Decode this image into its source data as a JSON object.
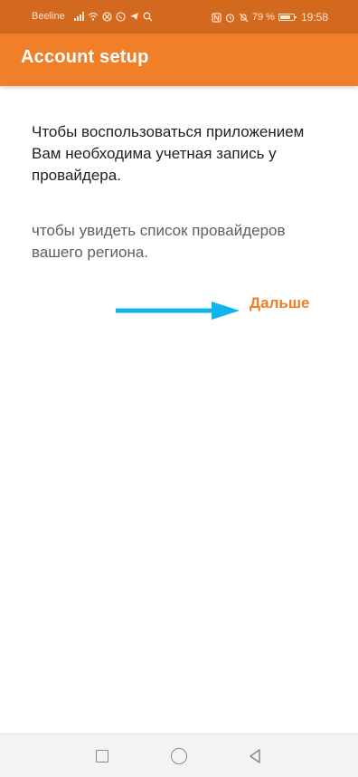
{
  "status_bar": {
    "carrier": "Beeline",
    "battery": "79 %",
    "time": "19:58",
    "icons": [
      "signal-icon",
      "wifi-icon",
      "blocked-icon",
      "whatsapp-icon",
      "telegram-icon",
      "search-icon",
      "nfc-icon",
      "alarm-icon",
      "mute-icon",
      "battery-icon"
    ],
    "battery_level": 0.79
  },
  "app_bar": {
    "title": "Account setup",
    "color": "#f07f2a"
  },
  "content": {
    "paragraph_1": "Чтобы воспользоваться приложением Вам необходима учетная запись у провайдера.",
    "paragraph_2": "чтобы увидеть список провайдеров вашего региона.",
    "next_label": "Дальше",
    "arrow_color": "#10b4ec",
    "accent_color": "#ec7f28"
  },
  "nav_bar": {
    "buttons": [
      "recents-square-icon",
      "home-circle-icon",
      "back-triangle-icon"
    ]
  }
}
